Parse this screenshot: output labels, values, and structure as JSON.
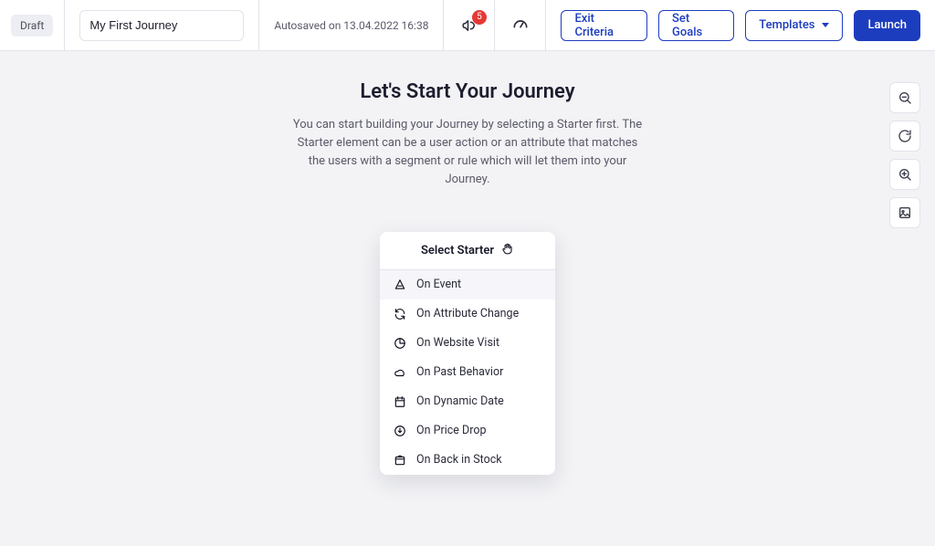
{
  "colors": {
    "accent": "#1d3dbf",
    "badge": "#e53935"
  },
  "header": {
    "status_badge": "Draft",
    "journey_name": "My First Journey",
    "autosave_text": "Autosaved on 13.04.2022 16:38",
    "notification_count": "5",
    "actions": {
      "exit_criteria": "Exit Criteria",
      "set_goals": "Set Goals",
      "templates": "Templates",
      "launch": "Launch"
    }
  },
  "intro": {
    "title": "Let's Start Your Journey",
    "subtitle": "You can start building your Journey by selecting a Starter first. The Starter element can be a user action or an attribute that matches the users with a segment or rule which will let them into your Journey."
  },
  "starter": {
    "header": "Select Starter",
    "options": [
      {
        "label": "On Event",
        "icon": "event"
      },
      {
        "label": "On Attribute Change",
        "icon": "sync"
      },
      {
        "label": "On Website Visit",
        "icon": "pie"
      },
      {
        "label": "On Past Behavior",
        "icon": "cloud"
      },
      {
        "label": "On Dynamic Date",
        "icon": "calendar"
      },
      {
        "label": "On Price Drop",
        "icon": "pricedrop"
      },
      {
        "label": "On Back in Stock",
        "icon": "box"
      }
    ]
  },
  "tools": {
    "zoom_out": "zoom-out",
    "reset": "reset",
    "zoom_in": "zoom-in",
    "export": "image-export"
  }
}
